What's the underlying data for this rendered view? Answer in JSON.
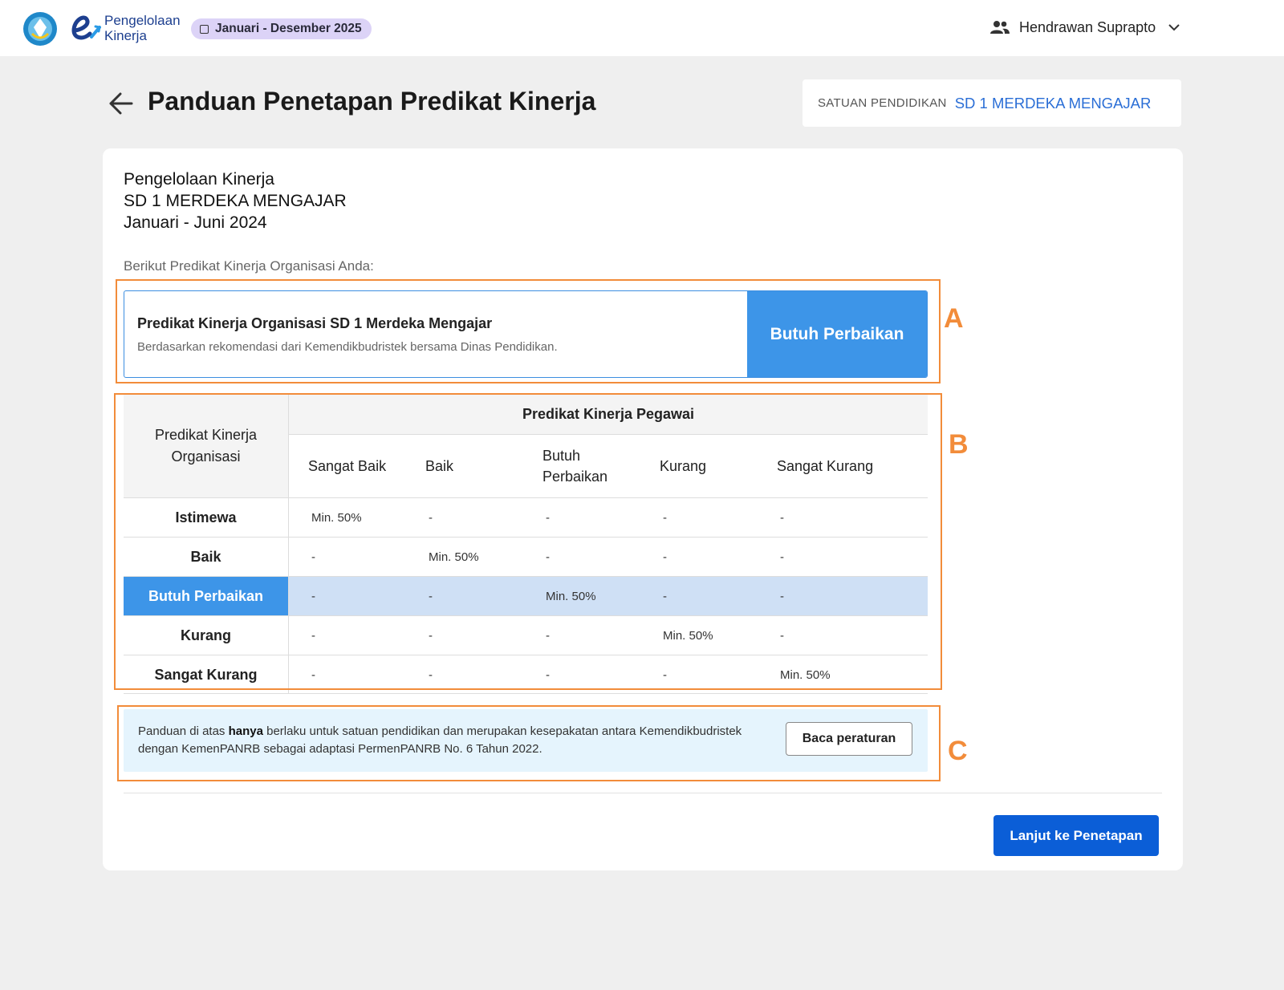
{
  "header": {
    "brand": [
      "Pengelolaan",
      "Kinerja"
    ],
    "period": "Januari - Desember 2025",
    "user_name": "Hendrawan Suprapto",
    "icons": {
      "emblem": "tut-wuri-handayani-emblem",
      "brand": "kinerja-logo-icon",
      "period": "calendar-square-icon",
      "user": "people-icon",
      "menu": "chevron-down-icon"
    }
  },
  "page": {
    "title": "Panduan Penetapan Predikat Kinerja",
    "back_icon": "arrow-left-icon",
    "unit_label": "SATUAN PENDIDIKAN",
    "unit_value": "SD 1 MERDEKA MENGAJAR"
  },
  "card": {
    "lines": [
      "Pengelolaan Kinerja",
      "SD 1 MERDEKA MENGAJAR",
      "Januari - Juni 2024"
    ],
    "subtitle": "Berikut Predikat Kinerja Organisasi Anda:"
  },
  "predikat": {
    "title": "Predikat Kinerja Organisasi SD 1 Merdeka Mengajar",
    "description": "Berdasarkan rekomendasi dari Kemendikbudristek bersama Dinas Pendidikan.",
    "status": "Butuh Perbaikan",
    "status_color": "#3d95e8"
  },
  "table": {
    "row_header": "Predikat Kinerja Organisasi",
    "group_header": "Predikat Kinerja Pegawai",
    "columns": [
      "Sangat Baik",
      "Baik",
      "Butuh Perbaikan",
      "Kurang",
      "Sangat Kurang"
    ],
    "rows": [
      {
        "name": "Istimewa",
        "cells": [
          "Min. 50%",
          "-",
          "-",
          "-",
          "-"
        ]
      },
      {
        "name": "Baik",
        "cells": [
          "-",
          "Min. 50%",
          "-",
          "-",
          "-"
        ]
      },
      {
        "name": "Butuh Perbaikan",
        "cells": [
          "-",
          "-",
          "Min. 50%",
          "-",
          "-"
        ],
        "highlight": true
      },
      {
        "name": "Kurang",
        "cells": [
          "-",
          "-",
          "-",
          "Min. 50%",
          "-"
        ]
      },
      {
        "name": "Sangat Kurang",
        "cells": [
          "-",
          "-",
          "-",
          "-",
          "Min. 50%"
        ]
      }
    ]
  },
  "note": {
    "before": "Panduan di atas ",
    "bold": "hanya",
    "after": " berlaku untuk satuan pendidikan dan merupakan kesepakatan antara Kemendikbudristek dengan KemenPANRB sebagai adaptasi PermenPANRB No. 6 Tahun 2022.",
    "button": "Baca peraturan"
  },
  "annotations": [
    "A",
    "B",
    "C"
  ],
  "annotation_color": "#f28c3a",
  "footer": {
    "next_button": "Lanjut ke Penetapan"
  }
}
